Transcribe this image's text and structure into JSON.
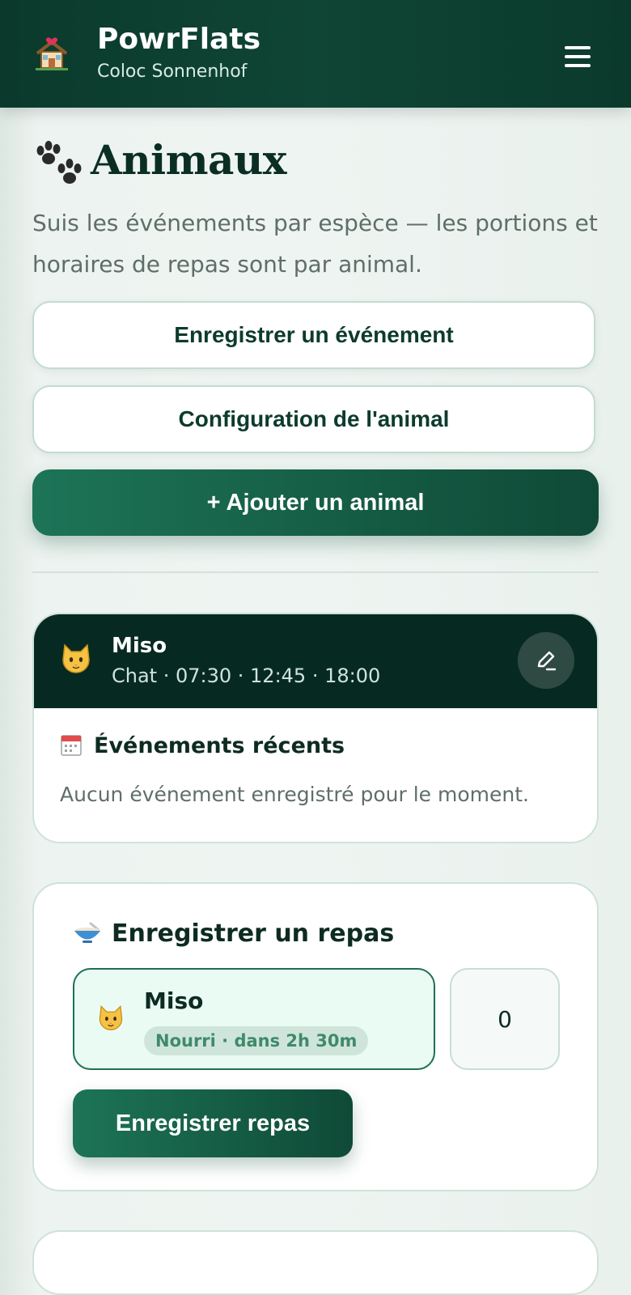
{
  "header": {
    "app_name": "PowrFlats",
    "subtitle": "Coloc Sonnenhof",
    "logo_icon": "house-with-heart-icon",
    "menu_icon": "hamburger-menu-icon"
  },
  "page": {
    "title_icon": "paw-prints-icon",
    "title": "Animaux",
    "description": "Suis les événements par espèce — les portions et horaires de repas sont par animal."
  },
  "actions": {
    "record_event": "Enregistrer un événement",
    "pet_config": "Configuration de l'animal",
    "add_pet": "+ Ajouter un animal"
  },
  "pet_card": {
    "icon": "cat-face-icon",
    "name": "Miso",
    "meta": "Chat · 07:30 · 12:45 · 18:00",
    "edit_icon": "pencil-icon",
    "events_icon": "calendar-icon",
    "events_title": "Événements récents",
    "events_empty": "Aucun événement enregistré pour le moment."
  },
  "meal_card": {
    "icon": "bowl-icon",
    "title": "Enregistrer un repas",
    "selected_pet": {
      "icon": "cat-face-icon",
      "name": "Miso",
      "status": "Nourri · dans 2h 30m"
    },
    "quantity": "0",
    "submit": "Enregistrer repas"
  },
  "colors": {
    "header_bg": "#0b3a2c",
    "primary": "#1d7457",
    "pet_header_bg": "#062a22",
    "selected_bg": "#eafbf4"
  }
}
